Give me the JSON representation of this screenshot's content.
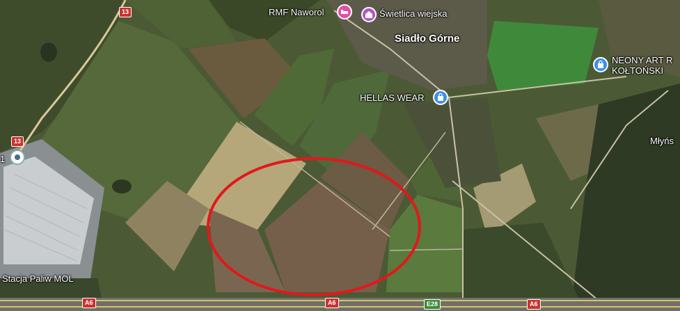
{
  "map": {
    "type": "satellite",
    "places": {
      "rmf": "RMF Naworol",
      "swietlica": "Świetlica wiejska",
      "village": "Siadło Górne",
      "hellas": "HELLAS WEAR",
      "neony_line1": "NEONY ART R",
      "neony_line2": "KOŁTOŃSKI",
      "mlyn": "Młyńs",
      "mol": "Stacja Paliw MOL",
      "edge_digit": "1"
    },
    "roads": {
      "r13_top": "13",
      "r13_mid": "13",
      "a6_left": "A6",
      "a6_mid": "A6",
      "e28": "E28",
      "a6_right": "A6"
    },
    "colors": {
      "annotation_circle": "#e0191b",
      "road_shield": "#c8332e",
      "poi_pink": "#e24fa8",
      "poi_purple": "#b553c9",
      "poi_blue": "#3f8fe6"
    },
    "icons": [
      "hotel-icon",
      "community-center-icon",
      "shopping-bag-icon",
      "location-marker-icon"
    ],
    "annotation": "red ellipse highlighting fields"
  }
}
